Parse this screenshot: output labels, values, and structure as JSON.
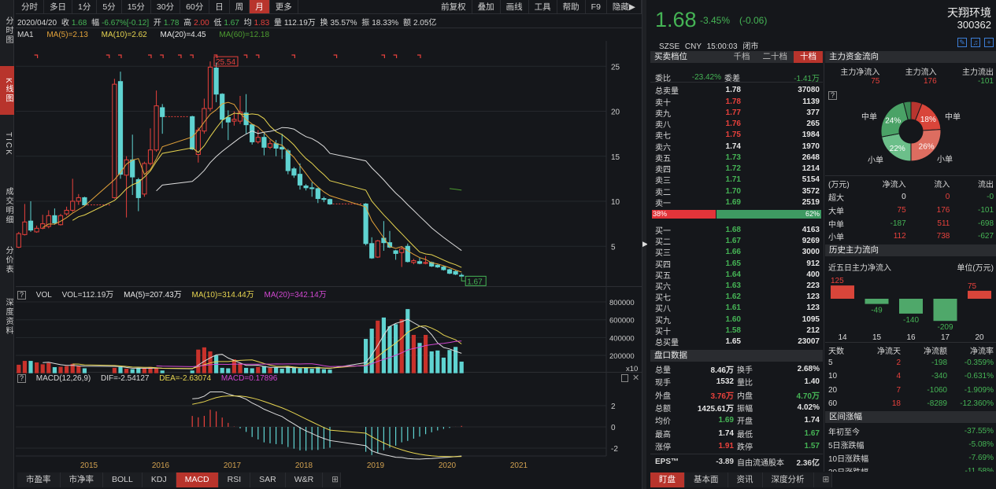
{
  "left_tabs": [
    "分时图",
    "K线图",
    "TICK",
    "成交明细",
    "分价表",
    "深度资料"
  ],
  "toolbar": {
    "periods": [
      "分时",
      "多日",
      "1分",
      "5分",
      "15分",
      "30分",
      "60分",
      "日",
      "周",
      "月",
      "更多"
    ],
    "active_period": "月",
    "tools": [
      "前复权",
      "叠加",
      "画线",
      "工具",
      "帮助",
      "F9",
      "隐藏▶"
    ]
  },
  "info": {
    "date": "2020/04/20",
    "close_label": "收",
    "close": "1.68",
    "change_label": "幅",
    "change": "-6.67%[-0.12]",
    "open_label": "开",
    "open": "1.78",
    "high_label": "高",
    "high": "2.00",
    "low_label": "低",
    "low": "1.67",
    "avg_label": "均",
    "avg": "1.83",
    "vol_label": "量",
    "vol": "112.19万",
    "turnover_label": "换",
    "turnover": "35.57%",
    "amp_label": "振",
    "amp": "18.33%",
    "amount_label": "额",
    "amount": "2.05亿"
  },
  "ma": {
    "name": "MA1",
    "ma5": "MA(5)=2.13",
    "ma10": "MA(10)=2.62",
    "ma20": "MA(20)=4.45",
    "ma60": "MA(60)=12.18"
  },
  "vol_header": {
    "q": "?",
    "name": "VOL",
    "vol": "VOL=112.19万",
    "ma5": "MA(5)=207.43万",
    "ma10": "MA(10)=314.44万",
    "ma20": "MA(20)=342.14万"
  },
  "macd_header": {
    "q": "?",
    "name": "MACD(12,26,9)",
    "dif": "DIF=-2.54127",
    "dea": "DEA=-2.63074",
    "macd": "MACD=0.17896"
  },
  "bottom_tabs": [
    "市盈率",
    "市净率",
    "BOLL",
    "KDJ",
    "MACD",
    "RSI",
    "SAR",
    "W&R"
  ],
  "active_bottom_tab": "MACD",
  "chart_data": {
    "type": "candlestick",
    "price_ticks": [
      "5",
      "10",
      "15",
      "20",
      "25"
    ],
    "vol_ticks": [
      "200000",
      "400000",
      "600000",
      "800000"
    ],
    "vol_unit": "x10",
    "macd_ticks": [
      "2",
      "0",
      "-2"
    ],
    "years": [
      "2015",
      "2016",
      "2017",
      "2018",
      "2019",
      "2020",
      "2021"
    ],
    "high_mark": "25.54",
    "low_mark": "1.67",
    "candles": [
      [
        4.9,
        6.6,
        4.8,
        6.4
      ],
      [
        6.3,
        9.7,
        6.2,
        7.7
      ],
      [
        7.8,
        10,
        6.6,
        6.8
      ],
      [
        6.6,
        7.3,
        6.5,
        7.0
      ],
      [
        7.0,
        8.5,
        6.9,
        7.5
      ],
      [
        7.2,
        9.0,
        7.0,
        8.4
      ],
      [
        8.4,
        9.2,
        7.4,
        7.6
      ],
      [
        7.4,
        8.6,
        7.3,
        8.4
      ],
      [
        8.6,
        9.4,
        8.4,
        9.0
      ],
      [
        9.0,
        12.5,
        8.8,
        10.0
      ],
      [
        10.0,
        10.8,
        9.6,
        10.4
      ],
      [
        10.4,
        10.5,
        9.5,
        9.6
      ],
      null,
      null,
      null,
      null,
      [
        10.4,
        23.6,
        10.3,
        23.0
      ],
      [
        23.3,
        24.4,
        12.5,
        13.0
      ],
      [
        12.9,
        15.0,
        8.2,
        14.6
      ],
      [
        14.6,
        17.4,
        10.7,
        12.7
      ],
      [
        12.4,
        12.6,
        8.9,
        10.4
      ],
      [
        10.8,
        14.4,
        10.5,
        14.2
      ],
      [
        14.2,
        18.1,
        14.0,
        15.7
      ],
      [
        15.7,
        22.3,
        15.5,
        20.6
      ],
      [
        20.4,
        20.8,
        17.5,
        19.4
      ],
      null,
      null,
      null,
      null,
      [
        19.4,
        19.5,
        15.7,
        15.8
      ],
      [
        15.2,
        18.2,
        14.3,
        17.9
      ],
      [
        17.8,
        21.4,
        17.5,
        20.3
      ],
      [
        20.3,
        25.54,
        20.0,
        24.9
      ],
      [
        24.8,
        25.4,
        21.0,
        21.9
      ],
      [
        21.9,
        22.0,
        18.1,
        19.1
      ],
      [
        19.3,
        20.1,
        16.8,
        18.8
      ],
      [
        18.9,
        20.0,
        18.4,
        19.1
      ],
      [
        18.9,
        21.7,
        18.6,
        19.9
      ],
      [
        19.8,
        21.9,
        17.5,
        18.5
      ],
      [
        18.5,
        18.6,
        16.3,
        16.6
      ],
      [
        16.6,
        17.9,
        16.4,
        17.1
      ],
      [
        17.1,
        17.7,
        15.1,
        16.0
      ],
      [
        16.0,
        16.8,
        15.8,
        16.4
      ],
      [
        16.4,
        16.8,
        15.0,
        15.9
      ],
      [
        16.0,
        17.5,
        14.7,
        15.8
      ],
      [
        15.6,
        15.8,
        13.0,
        13.4
      ],
      [
        13.6,
        13.8,
        12.6,
        12.9
      ],
      [
        13.0,
        14.2,
        11.3,
        11.8
      ],
      [
        11.7,
        11.9,
        11.2,
        11.5
      ],
      [
        11.5,
        12.1,
        10.5,
        11.4
      ],
      [
        11.4,
        11.5,
        9.8,
        10.3
      ],
      [
        10.3,
        10.5,
        9.9,
        10.2
      ],
      [
        10.2,
        10.3,
        9.6,
        9.7
      ],
      null,
      null,
      null,
      null,
      null,
      [
        9.7,
        9.8,
        5.1,
        5.3
      ],
      [
        5.3,
        6.0,
        3.6,
        3.7
      ],
      [
        3.8,
        5.7,
        3.7,
        5.6
      ],
      [
        5.9,
        7.8,
        4.5,
        5.4
      ],
      [
        5.4,
        6.7,
        4.8,
        4.9
      ],
      [
        4.5,
        4.6,
        3.5,
        4.2
      ],
      [
        4.3,
        5.0,
        2.7,
        4.7
      ],
      [
        5.0,
        5.3,
        3.2,
        3.3
      ],
      [
        3.2,
        3.6,
        3.0,
        3.4
      ],
      [
        3.3,
        3.7,
        3.0,
        3.1
      ],
      [
        3.1,
        3.9,
        3.0,
        3.2
      ],
      [
        3.2,
        3.3,
        2.7,
        2.8
      ],
      [
        2.9,
        3.0,
        2.6,
        2.7
      ],
      [
        2.7,
        2.8,
        2.3,
        2.4
      ],
      [
        2.4,
        2.5,
        1.9,
        2.0
      ],
      [
        2.2,
        2.3,
        1.8,
        1.9
      ],
      [
        1.78,
        2.0,
        1.67,
        1.68
      ]
    ],
    "volumes": [
      95000,
      138000,
      138000,
      121000,
      100000,
      115000,
      68000,
      72000,
      80000,
      105000,
      85000,
      55000,
      null,
      null,
      null,
      null,
      60000,
      70000,
      50000,
      45000,
      60000,
      55000,
      70000,
      60000,
      30000,
      null,
      null,
      null,
      null,
      30000,
      265000,
      290000,
      245000,
      200000,
      60000,
      55000,
      155000,
      110000,
      60000,
      55000,
      70000,
      80000,
      60000,
      65000,
      50000,
      75000,
      60000,
      55000,
      65000,
      50000,
      70000,
      45000,
      40000,
      null,
      null,
      null,
      null,
      null,
      385000,
      500000,
      590000,
      625000,
      527000,
      550000,
      605000,
      720000,
      430000,
      340000,
      430000,
      245000,
      255000,
      175000,
      260000,
      295000,
      130000
    ]
  },
  "quote": {
    "price": "1.68",
    "pct": "-3.45%",
    "chg": "(-0.06)",
    "name": "天翔环境",
    "code": "300362",
    "exchange": "SZSE",
    "currency": "CNY",
    "time": "15:00:03",
    "status": "闭市"
  },
  "orderbook": {
    "title": "买卖档位",
    "tabs": [
      "千档",
      "二十档",
      "十档"
    ],
    "active_tab": "十档",
    "weibi_label": "委比",
    "weibi": "-23.42%",
    "weicha_label": "委差",
    "weicha": "-1.41万",
    "total_sell": {
      "label": "总卖量",
      "price": "1.78",
      "vol": "37080"
    },
    "asks": [
      {
        "label": "卖十",
        "price": "1.78",
        "vol": "1139",
        "c": "red"
      },
      {
        "label": "卖九",
        "price": "1.77",
        "vol": "377",
        "c": "red"
      },
      {
        "label": "卖八",
        "price": "1.76",
        "vol": "265",
        "c": "red"
      },
      {
        "label": "卖七",
        "price": "1.75",
        "vol": "1984",
        "c": "red"
      },
      {
        "label": "卖六",
        "price": "1.74",
        "vol": "1970",
        "c": "white"
      },
      {
        "label": "卖五",
        "price": "1.73",
        "vol": "2648",
        "c": "green"
      },
      {
        "label": "卖四",
        "price": "1.72",
        "vol": "1214",
        "c": "green"
      },
      {
        "label": "卖三",
        "price": "1.71",
        "vol": "5154",
        "c": "green"
      },
      {
        "label": "卖二",
        "price": "1.70",
        "vol": "3572",
        "c": "green"
      },
      {
        "label": "卖一",
        "price": "1.69",
        "vol": "2519",
        "c": "green"
      }
    ],
    "ratio": {
      "left_pct": 38,
      "right_pct": 62,
      "left_label": "38%",
      "right_label": "62%"
    },
    "bids": [
      {
        "label": "买一",
        "price": "1.68",
        "vol": "4163",
        "c": "green"
      },
      {
        "label": "买二",
        "price": "1.67",
        "vol": "9269",
        "c": "green"
      },
      {
        "label": "买三",
        "price": "1.66",
        "vol": "3000",
        "c": "green"
      },
      {
        "label": "买四",
        "price": "1.65",
        "vol": "912",
        "c": "green"
      },
      {
        "label": "买五",
        "price": "1.64",
        "vol": "400",
        "c": "green"
      },
      {
        "label": "买六",
        "price": "1.63",
        "vol": "223",
        "c": "green"
      },
      {
        "label": "买七",
        "price": "1.62",
        "vol": "123",
        "c": "green"
      },
      {
        "label": "买八",
        "price": "1.61",
        "vol": "123",
        "c": "green"
      },
      {
        "label": "买九",
        "price": "1.60",
        "vol": "1095",
        "c": "green"
      },
      {
        "label": "买十",
        "price": "1.58",
        "vol": "212",
        "c": "green"
      }
    ],
    "total_buy": {
      "label": "总买量",
      "price": "1.65",
      "vol": "23007"
    }
  },
  "pankou": {
    "title": "盘口数据",
    "rows": [
      {
        "l1": "总量",
        "v1": "8.46万",
        "c1": "white",
        "l2": "换手",
        "v2": "2.68%",
        "c2": "white"
      },
      {
        "l1": "现手",
        "v1": "1532",
        "c1": "white",
        "l2": "量比",
        "v2": "1.40",
        "c2": "white"
      },
      {
        "l1": "外盘",
        "v1": "3.76万",
        "c1": "red",
        "l2": "内盘",
        "v2": "4.70万",
        "c2": "green"
      },
      {
        "l1": "总额",
        "v1": "1425.61万",
        "c1": "white",
        "l2": "振幅",
        "v2": "4.02%",
        "c2": "white"
      },
      {
        "l1": "均价",
        "v1": "1.69",
        "c1": "green",
        "l2": "开盘",
        "v2": "1.74",
        "c2": "white"
      },
      {
        "l1": "最高",
        "v1": "1.74",
        "c1": "white",
        "l2": "最低",
        "v2": "1.67",
        "c2": "green"
      },
      {
        "l1": "涨停",
        "v1": "1.91",
        "c1": "red",
        "l2": "跌停",
        "v2": "1.57",
        "c2": "green"
      }
    ],
    "eps_label": "EPS™",
    "eps": "-3.89",
    "float_label": "自由流通股本",
    "float": "2.36亿"
  },
  "right_bottom_tabs": [
    "盯盘",
    "基本面",
    "资讯",
    "深度分析"
  ],
  "active_right_tab": "盯盘",
  "capital_flow": {
    "title": "主力资金流向",
    "headers": [
      "主力净流入",
      "主力流入",
      "主力流出"
    ],
    "values": [
      "75",
      "176",
      "-101"
    ],
    "q": "?",
    "donut": [
      {
        "pct": 6,
        "color": "#b8352f"
      },
      {
        "pct": 18,
        "color": "#d9453a",
        "label": "18%"
      },
      {
        "pct": 26,
        "color": "#dd6d60",
        "label": "26%"
      },
      {
        "pct": 22,
        "color": "#6cbf8a",
        "label": "22%"
      },
      {
        "pct": 24,
        "color": "#4aa266",
        "label": "24%"
      },
      {
        "pct": 4,
        "color": "#3c8a55"
      }
    ],
    "donut_labels": {
      "mid_left": "中单",
      "mid_right": "中单",
      "small_left": "小单",
      "small_right": "小单"
    },
    "table_headers": [
      "(万元)",
      "净流入",
      "流入",
      "流出"
    ],
    "table": [
      {
        "k": "超大",
        "net": "0",
        "in": "0",
        "out": "-0",
        "nc": "white"
      },
      {
        "k": "大单",
        "net": "75",
        "in": "176",
        "out": "-101",
        "nc": "red"
      },
      {
        "k": "中单",
        "net": "-187",
        "in": "511",
        "out": "-698",
        "nc": "green"
      },
      {
        "k": "小单",
        "net": "112",
        "in": "738",
        "out": "-627",
        "nc": "red"
      }
    ]
  },
  "history_flow": {
    "title": "历史主力流向",
    "subtitle": "近五日主力净流入",
    "unit": "单位(万元)",
    "days": [
      "14",
      "15",
      "16",
      "17",
      "20"
    ],
    "values": [
      125,
      -49,
      -140,
      -209,
      75
    ],
    "value_labels": [
      "125",
      "-49",
      "-140",
      "-209",
      "75"
    ],
    "table_headers": [
      "天数",
      "净流天",
      "净流额",
      "净流率"
    ],
    "table": [
      {
        "d": "5",
        "n": "2",
        "amt": "-198",
        "rate": "-0.359%"
      },
      {
        "d": "10",
        "n": "4",
        "amt": "-340",
        "rate": "-0.631%"
      },
      {
        "d": "20",
        "n": "7",
        "amt": "-1060",
        "rate": "-1.909%"
      },
      {
        "d": "60",
        "n": "18",
        "amt": "-8289",
        "rate": "-12.360%"
      }
    ]
  },
  "range_change": {
    "title": "区间涨幅",
    "rows": [
      {
        "k": "年初至今",
        "v": "-37.55%"
      },
      {
        "k": "5日涨跌幅",
        "v": "-5.08%"
      },
      {
        "k": "10日涨跌幅",
        "v": "-7.69%"
      },
      {
        "k": "20日涨跌幅",
        "v": "-11.58%"
      }
    ]
  },
  "colors": {
    "up": "#e8413c",
    "down": "#5fd3d1",
    "accent": "#b8342c",
    "green": "#45b455"
  }
}
